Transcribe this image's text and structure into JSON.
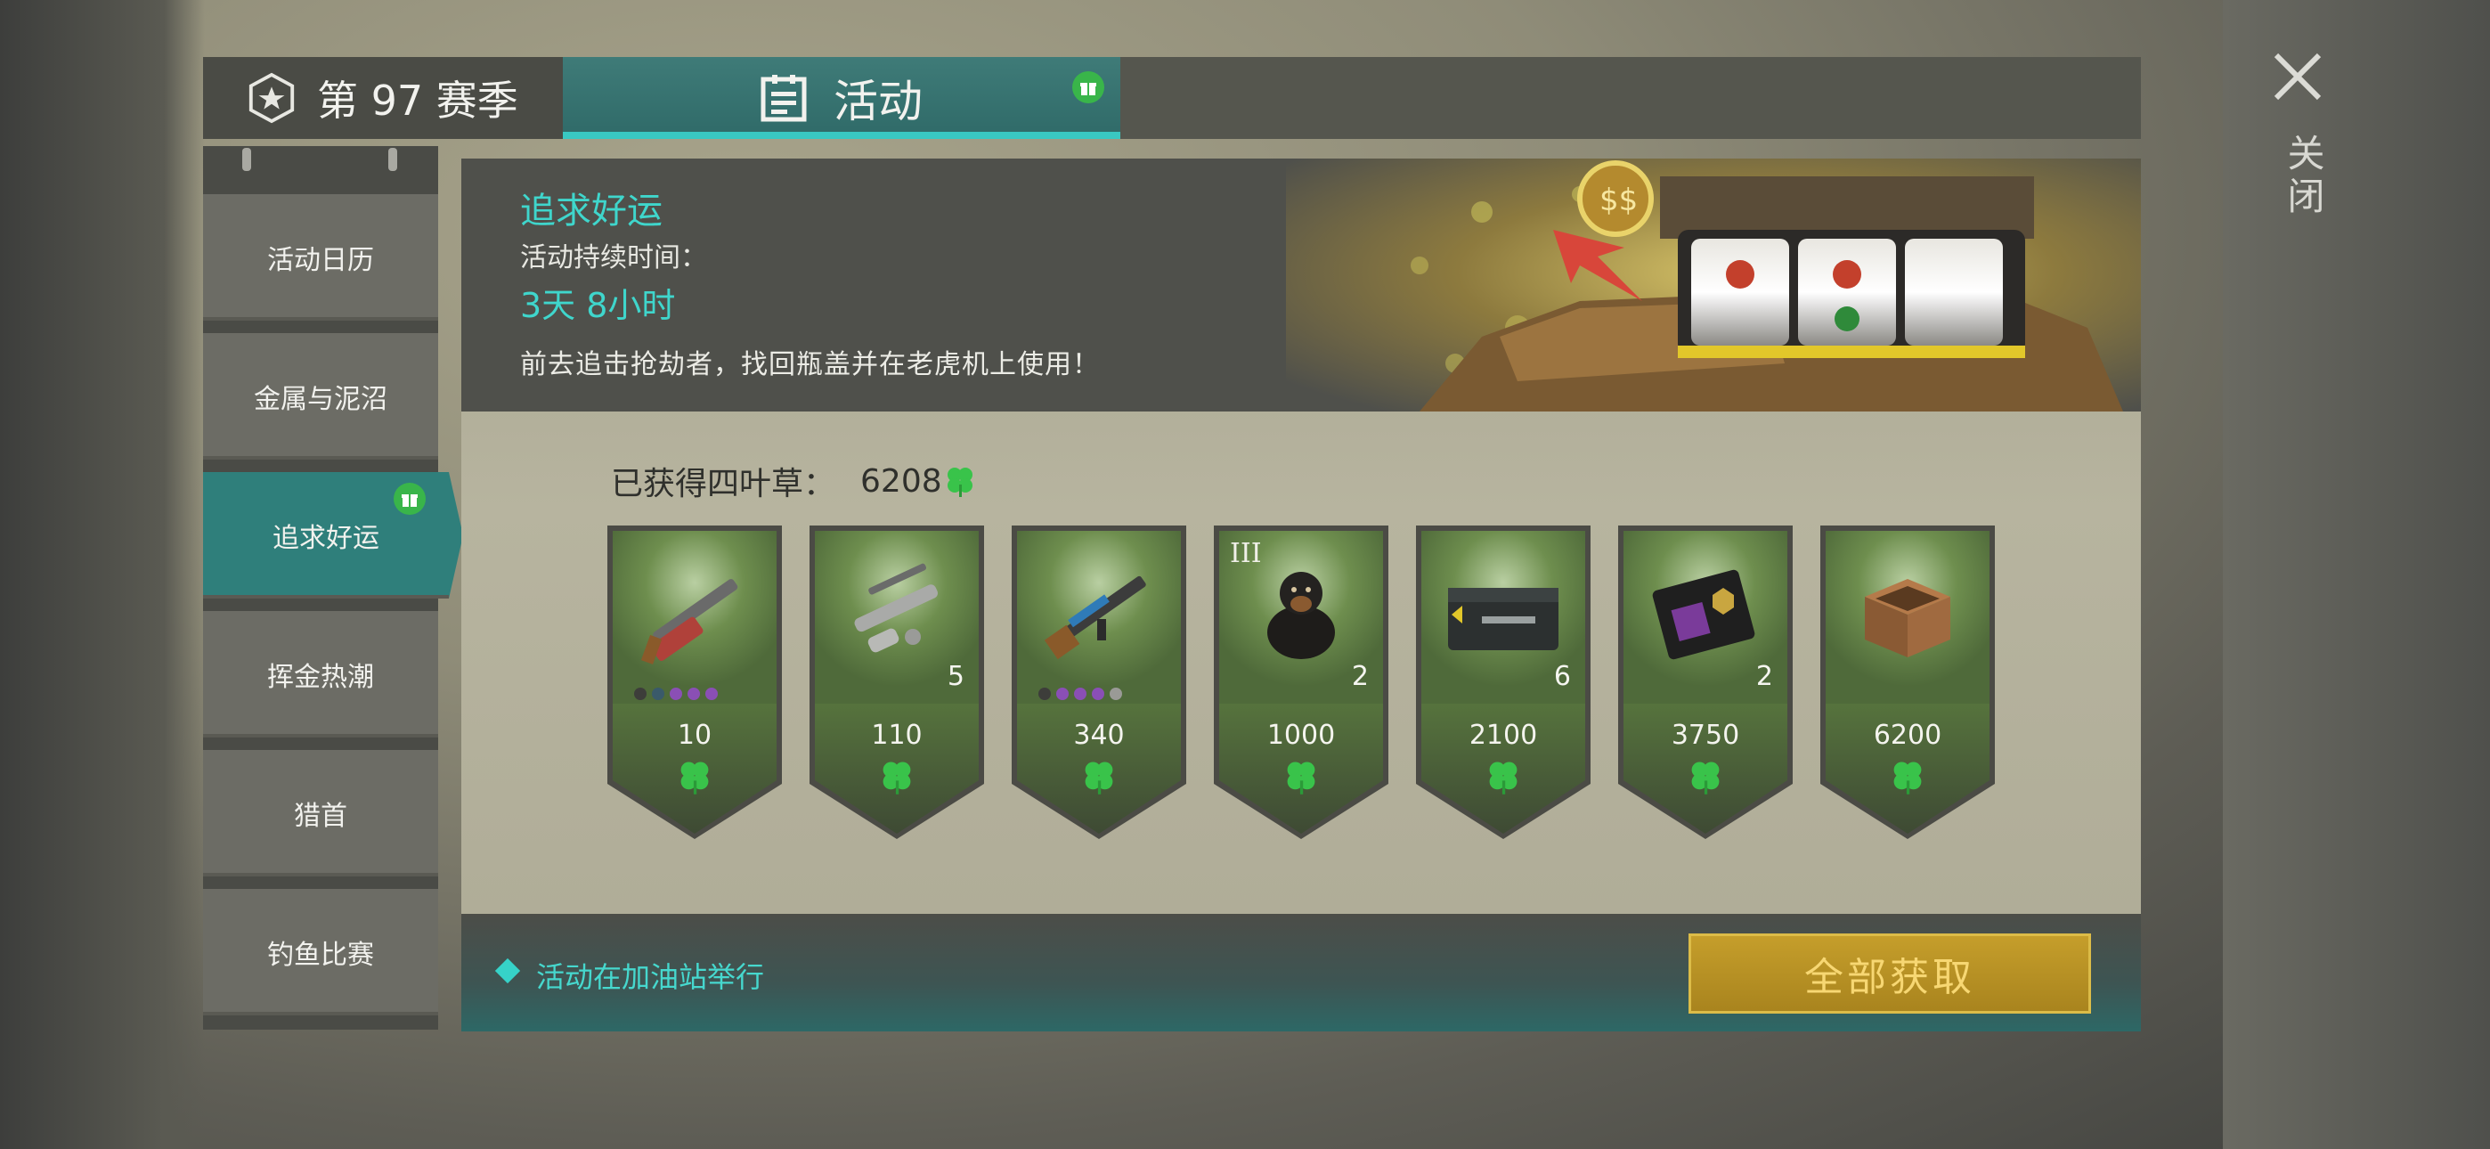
{
  "tabs": {
    "season_label": "第 97 赛季",
    "activity_label": "活动"
  },
  "sidebar": {
    "items": [
      {
        "label": "活动日历"
      },
      {
        "label": "金属与泥沼"
      },
      {
        "label": "追求好运"
      },
      {
        "label": "挥金热潮"
      },
      {
        "label": "猎首"
      },
      {
        "label": "钓鱼比赛"
      }
    ],
    "active_index": 2
  },
  "event": {
    "title": "追求好运",
    "duration_label": "活动持续时间：",
    "duration": "3天 8小时",
    "description": "前去追击抢劫者，找回瓶盖并在老虎机上使用！"
  },
  "clovers": {
    "label": "已获得四叶草：",
    "value": "6208"
  },
  "rewards": [
    {
      "icon": "shotgun-icon",
      "price": "10",
      "qty": "",
      "tier": "",
      "dots": [
        "#3d3d3a",
        "#3a5a6a",
        "#8a4fb5",
        "#8a4fb5",
        "#8a4fb5"
      ]
    },
    {
      "icon": "weapon-parts-icon",
      "price": "110",
      "qty": "5",
      "tier": "",
      "dots": []
    },
    {
      "icon": "assault-rifle-icon",
      "price": "340",
      "qty": "",
      "tier": "",
      "dots": [
        "#3d3d3a",
        "#8a4fb5",
        "#8a4fb5",
        "#8a4fb5",
        "#9a9a96"
      ]
    },
    {
      "icon": "rottweiler-dog-icon",
      "price": "1000",
      "qty": "2",
      "tier": "III",
      "dots": []
    },
    {
      "icon": "weapon-crate-icon",
      "price": "2100",
      "qty": "6",
      "tier": "",
      "dots": []
    },
    {
      "icon": "police-badge-icon",
      "price": "3750",
      "qty": "2",
      "tier": "",
      "dots": []
    },
    {
      "icon": "wooden-crate-icon",
      "price": "6200",
      "qty": "",
      "tier": "",
      "dots": []
    }
  ],
  "footer": {
    "note": "活动在加油站举行",
    "claim_all_label": "全部获取"
  },
  "close_label": "关闭",
  "colors": {
    "accent": "#3fd6cc",
    "tab_active": "#2f6a68",
    "button_gold": "#c59e2b",
    "clover_green": "#39c34a"
  }
}
